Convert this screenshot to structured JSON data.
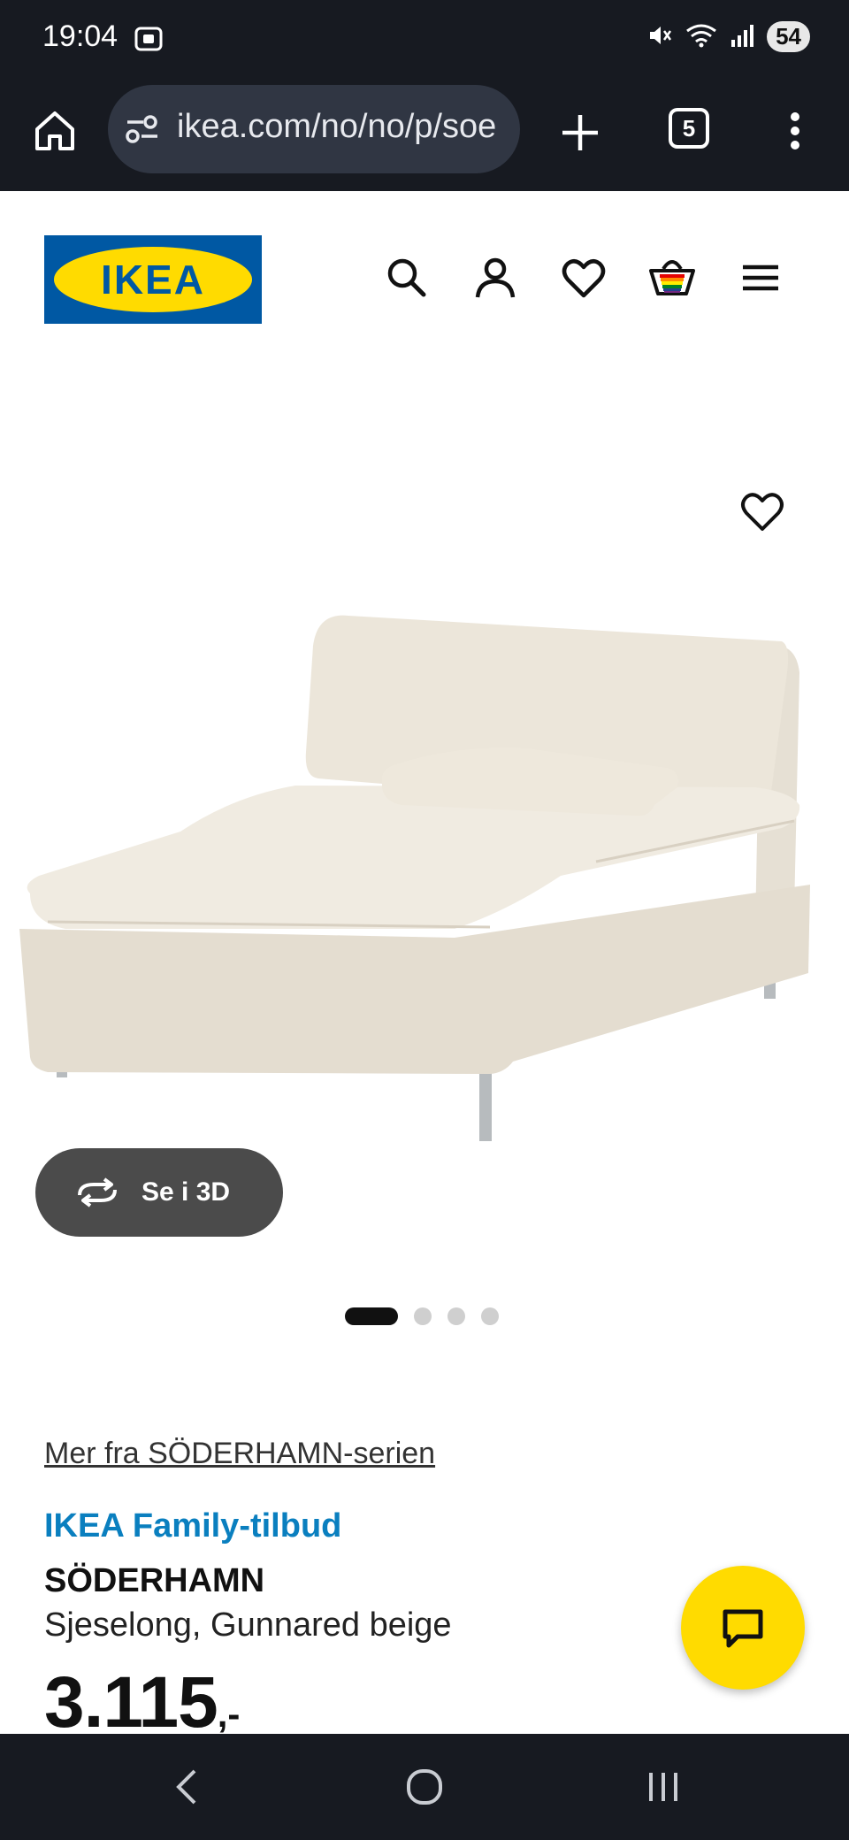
{
  "status_bar": {
    "time": "19:04",
    "battery": "54"
  },
  "browser": {
    "url": "ikea.com/no/no/p/soe",
    "tab_count": "5"
  },
  "header": {
    "logo_text": "IKEA",
    "icons": [
      "search-icon",
      "account-icon",
      "wishlist-icon",
      "cart-icon",
      "hamburger-menu-icon"
    ]
  },
  "gallery": {
    "view_3d_label": "Se i 3D",
    "slide_count": 4,
    "active_slide": 1
  },
  "product": {
    "series_link": "Mer fra SÖDERHAMN-serien",
    "offer_label": "IKEA Family-tilbud",
    "name": "SÖDERHAMN",
    "description": "Sjeselong, Gunnared beige",
    "price_number": "3.115",
    "price_suffix": ",-"
  },
  "colors": {
    "ikea_blue": "#0058a3",
    "ikea_yellow": "#ffdb00",
    "offer_blue": "#0a7fbf",
    "system_bar": "#171a21"
  }
}
